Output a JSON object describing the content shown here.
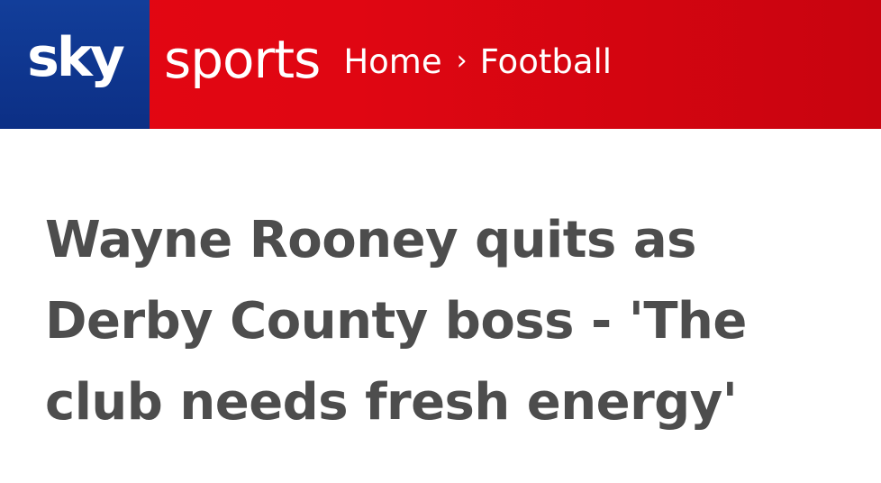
{
  "brand": {
    "sky_text": "sky",
    "sports_text": "sports"
  },
  "breadcrumb": {
    "items": [
      "Home",
      "Football"
    ],
    "separator": "›"
  },
  "article": {
    "headline": "Wayne Rooney quits as Derby County boss - 'The club needs fresh energy'"
  },
  "colors": {
    "brand_red": "#e30613",
    "brand_blue": "#0c2f85",
    "headline_text": "#4d4d4d"
  }
}
